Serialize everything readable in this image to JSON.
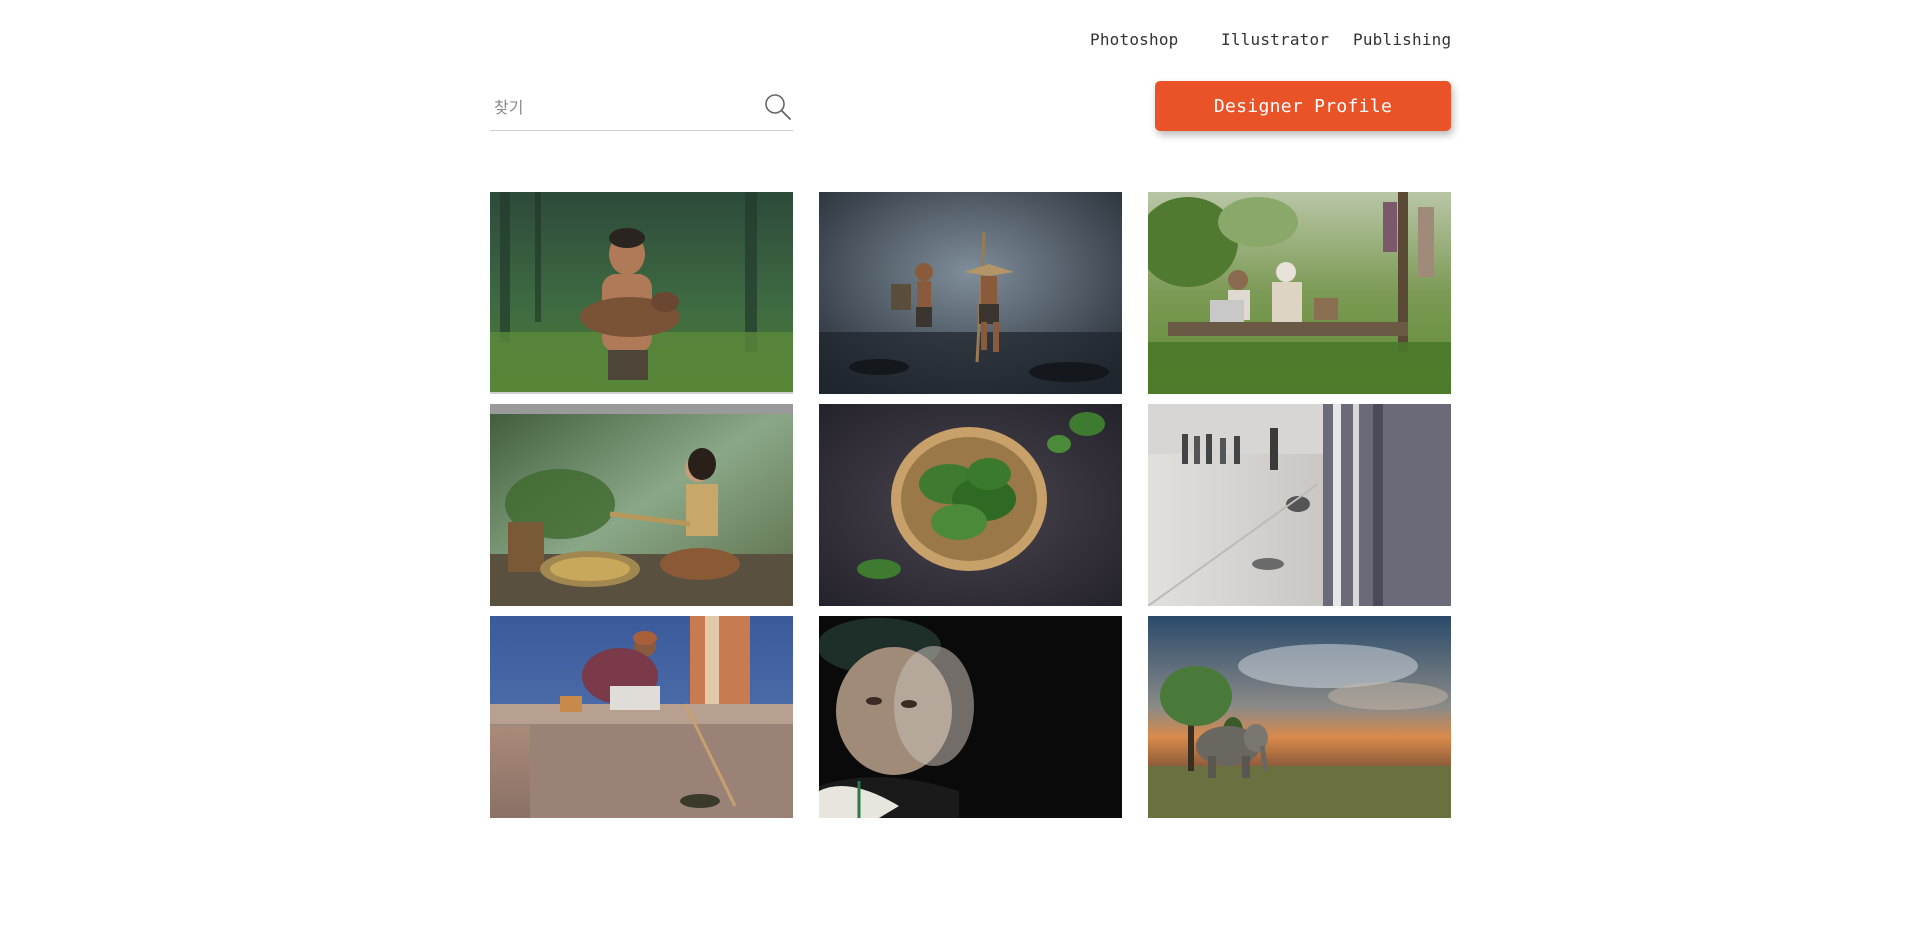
{
  "nav": {
    "items": [
      {
        "label": "Photoshop"
      },
      {
        "label": "Illustrator"
      },
      {
        "label": "Publishing"
      }
    ]
  },
  "search": {
    "placeholder": "찾기",
    "value": "",
    "icon": "search-icon"
  },
  "cta": {
    "label": "Designer Profile",
    "color": "#ea5328"
  },
  "gallery": {
    "photos": [
      {
        "subject": "boy-holding-goat"
      },
      {
        "subject": "boys-fishing-in-stream"
      },
      {
        "subject": "child-with-laptop-and-grandmother"
      },
      {
        "subject": "woman-winnowing-rice"
      },
      {
        "subject": "bowl-of-spinach"
      },
      {
        "subject": "street-with-beggars-hands"
      },
      {
        "subject": "old-man-sitting-on-step"
      },
      {
        "subject": "elderly-woman-portrait"
      },
      {
        "subject": "elephant-at-sunset"
      }
    ]
  }
}
